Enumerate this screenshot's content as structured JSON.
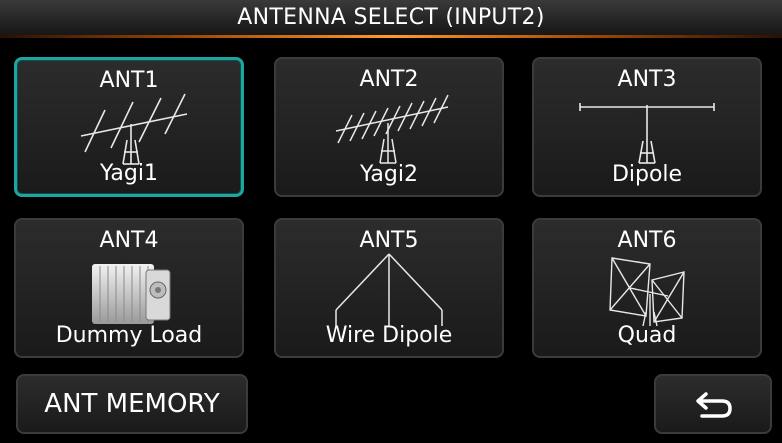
{
  "header": {
    "title": "ANTENNA SELECT (INPUT2)"
  },
  "antennas": [
    {
      "id": "ANT1",
      "name": "Yagi1",
      "icon": "yagi-antenna-icon",
      "selected": true
    },
    {
      "id": "ANT2",
      "name": "Yagi2",
      "icon": "yagi-long-antenna-icon",
      "selected": false
    },
    {
      "id": "ANT3",
      "name": "Dipole",
      "icon": "dipole-antenna-icon",
      "selected": false
    },
    {
      "id": "ANT4",
      "name": "Dummy Load",
      "icon": "dummy-load-icon",
      "selected": false
    },
    {
      "id": "ANT5",
      "name": "Wire Dipole",
      "icon": "wire-dipole-icon",
      "selected": false
    },
    {
      "id": "ANT6",
      "name": "Quad",
      "icon": "quad-antenna-icon",
      "selected": false
    }
  ],
  "footer": {
    "memory_label": "ANT MEMORY",
    "back_icon": "return-arrow-icon"
  },
  "colors": {
    "selected_border": "#1fa5a0",
    "title_glow": "#ff9a2e",
    "background": "#000000"
  }
}
